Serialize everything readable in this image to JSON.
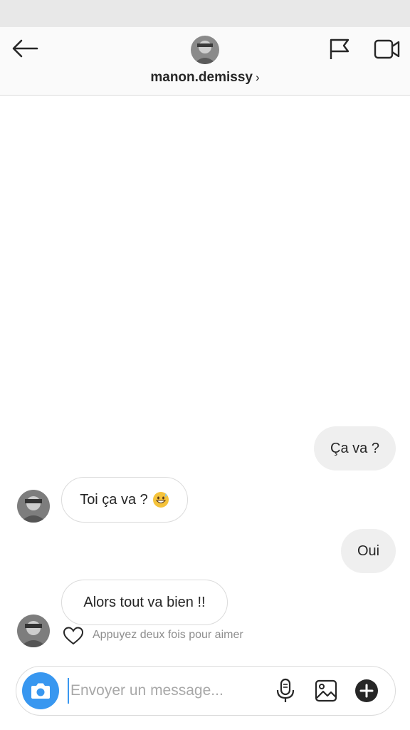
{
  "header": {
    "username": "manon.demissy",
    "chevron": "›",
    "icons": [
      "back-arrow-icon",
      "profile-avatar",
      "flag-icon",
      "video-call-icon"
    ]
  },
  "messages": [
    {
      "from": "me",
      "text": "Ça va ?"
    },
    {
      "from": "them",
      "text": "Toi ça va ?",
      "emoji": "grinning-sweat-emoji"
    },
    {
      "from": "me",
      "text": "Oui"
    },
    {
      "from": "them",
      "text": "Alors tout va bien !!"
    }
  ],
  "like_hint": "Appuyez deux fois pour aimer",
  "composer": {
    "placeholder": "Envoyer un message...",
    "icons": [
      "camera-icon",
      "microphone-icon",
      "gallery-icon",
      "plus-icon"
    ]
  },
  "colors": {
    "accent": "#3897f0",
    "my_bubble": "#efefef",
    "border": "#dbdbdb",
    "hint_text": "#8e8e8e"
  }
}
